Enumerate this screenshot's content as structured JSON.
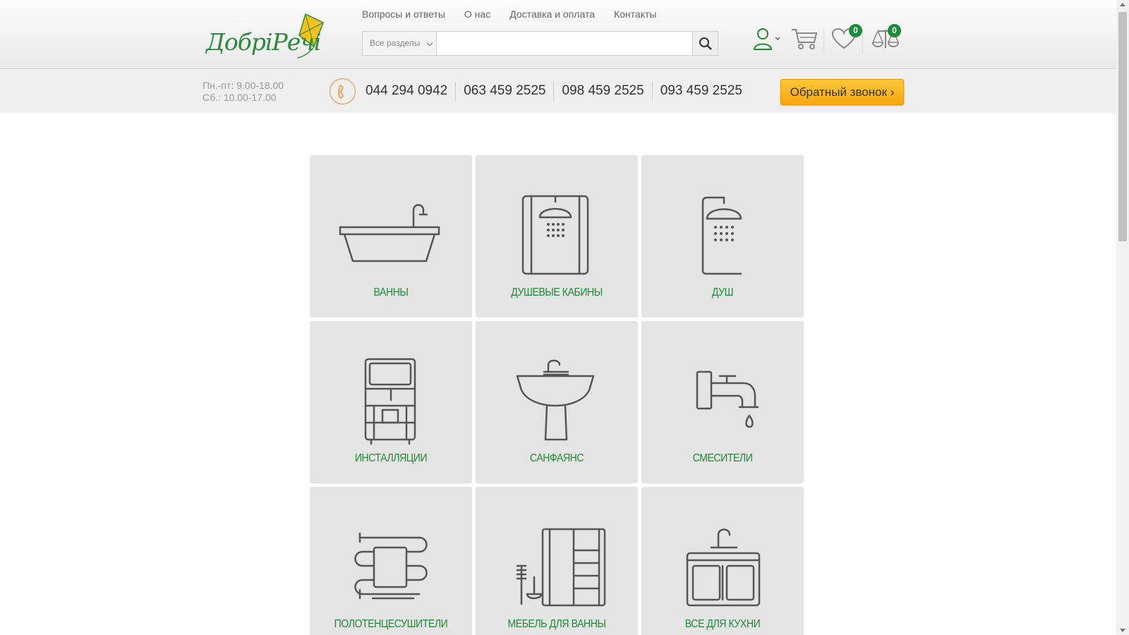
{
  "logo": {
    "text": "ДобріРечі"
  },
  "topnav": [
    "Вопросы и ответы",
    "О нас",
    "Доставка и оплата",
    "Контакты"
  ],
  "search": {
    "category": "Все разделы",
    "query": ""
  },
  "header_icons": {
    "wishlist_count": "0",
    "compare_count": "0"
  },
  "contact": {
    "hours_weekdays": "Пн.-пт: 9.00-18.00",
    "hours_saturday": "Сб.: 10.00-17.00",
    "phones": [
      "044 294 0942",
      "063 459 2525",
      "098 459 2525",
      "093 459 2525"
    ],
    "callback_label": "Обратный звонок ›"
  },
  "categories": [
    {
      "label": "ВАННЫ",
      "icon": "bathtub-icon"
    },
    {
      "label": "ДУШЕВЫЕ КАБИНЫ",
      "icon": "shower-cabin-icon"
    },
    {
      "label": "ДУШ",
      "icon": "shower-icon"
    },
    {
      "label": "ИНСТАЛЛЯЦИИ",
      "icon": "installation-icon"
    },
    {
      "label": "САНФАЯНС",
      "icon": "washbasin-icon"
    },
    {
      "label": "СМЕСИТЕЛИ",
      "icon": "faucet-icon"
    },
    {
      "label": "ПОЛОТЕНЦЕСУШИТЕЛИ",
      "icon": "towel-dryer-icon"
    },
    {
      "label": "МЕБЕЛЬ ДЛЯ ВАННЫ",
      "icon": "bathroom-furniture-icon"
    },
    {
      "label": "ВСЕ ДЛЯ КУХНИ",
      "icon": "kitchen-sink-icon"
    }
  ],
  "colors": {
    "brand_green": "#1f8a35",
    "accent_orange": "#f5a70b",
    "tile_bg": "#e4e4e4"
  }
}
